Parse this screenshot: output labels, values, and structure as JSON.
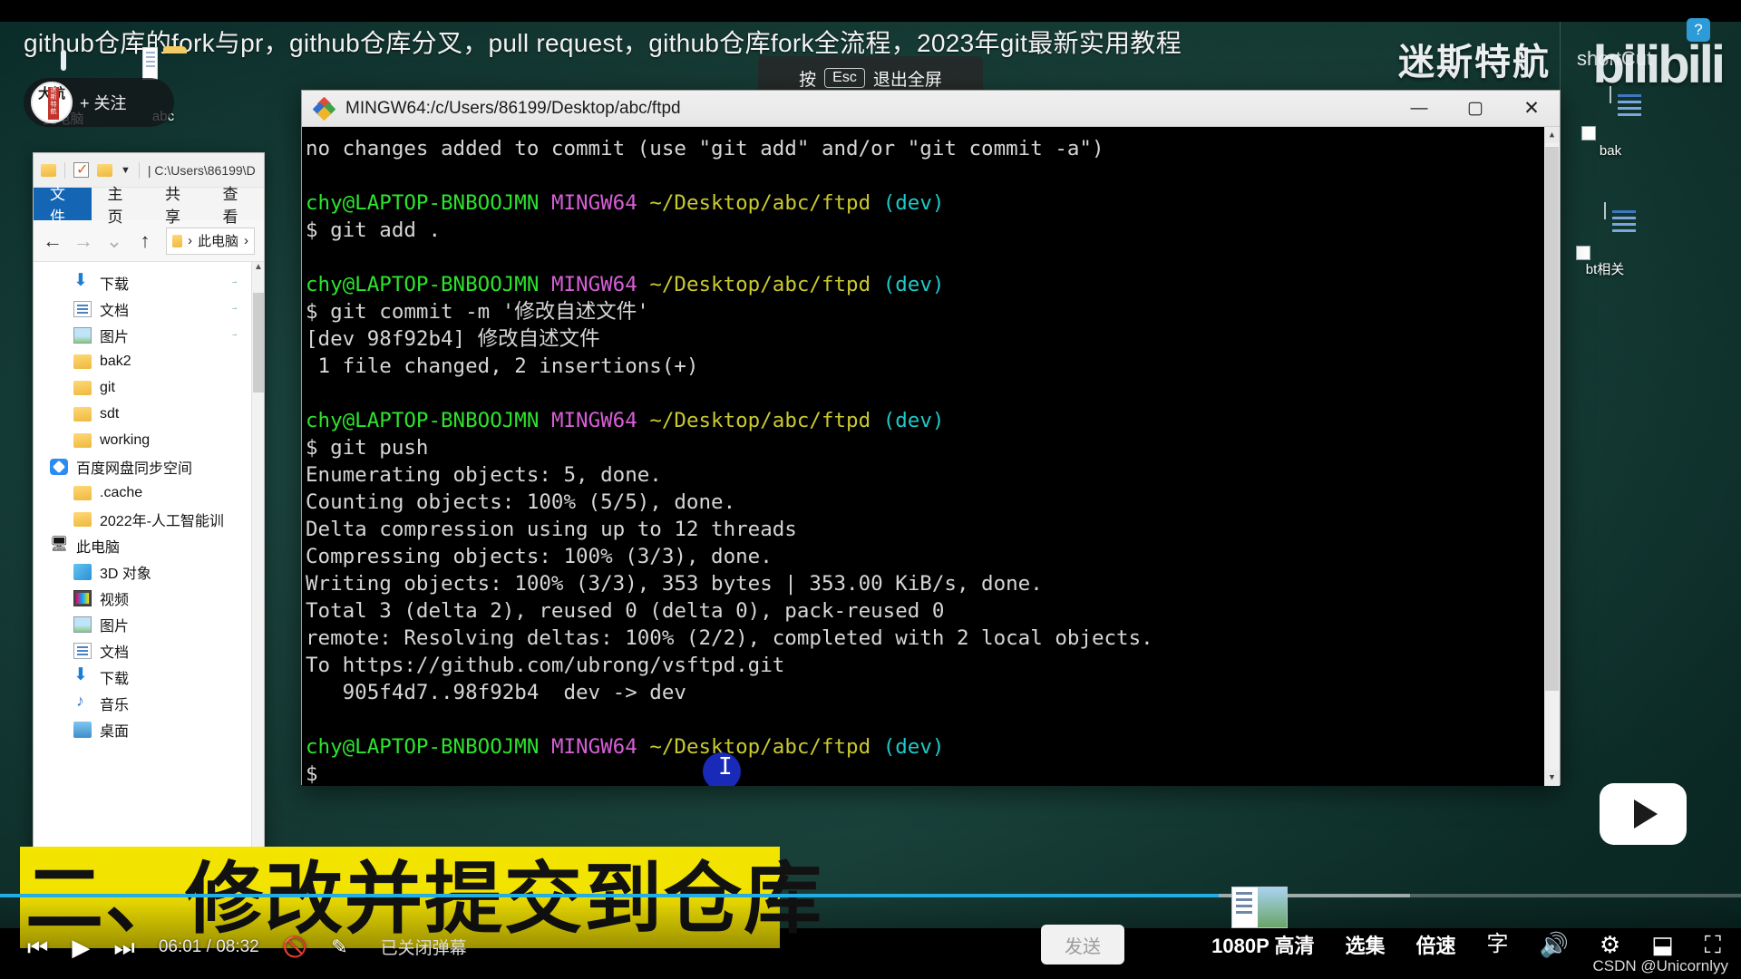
{
  "video": {
    "title": "github仓库的fork与pr，github仓库分叉，pull request，github仓库fork全流程，2023年git最新实用教程",
    "shortcut_label": "shortCut",
    "uploader": "迷斯特航",
    "brand": "bilibili",
    "help_icon": "?",
    "follow_label": "+ 关注",
    "avatar_text": "大航",
    "avatar_banner": "迷斯特航",
    "esc_hint": {
      "prefix": "按",
      "key": "Esc",
      "suffix": "退出全屏"
    },
    "subtitle": "二、修改并提交到仓库",
    "watermark": "CSDN @Unicornlyy"
  },
  "player": {
    "prev_icon": "⏮",
    "play_icon": "▶",
    "next_icon": "⏭",
    "time": "06:01 / 08:32",
    "danmaku_toggle_icon": "danmaku-off-icon",
    "danmaku_style_icon": "danmaku-style-icon",
    "danmaku_status": "已关闭弹幕",
    "send_label": "发送",
    "quality": "1080P 高清",
    "episodes": "选集",
    "speed": "倍速",
    "subtitle_icon": "subtitle-off-icon",
    "volume_icon": "volume-icon",
    "settings_icon": "gear-icon",
    "widescreen_icon": "widescreen-icon",
    "fullscreen_icon": "fullscreen-icon",
    "progress_percent": 70,
    "buffered_percent": 81
  },
  "desktop_icons": [
    {
      "label": "此电脑",
      "icon": "this-pc-icon"
    },
    {
      "label": "abc",
      "icon": "folder-icon"
    },
    {
      "label": "bak",
      "icon": "shortcut-file-icon"
    },
    {
      "label": "bt相关",
      "icon": "shortcut-file-icon"
    }
  ],
  "explorer": {
    "quick_access": {
      "path": "| C:\\Users\\86199\\D"
    },
    "tabs": [
      {
        "label": "文件",
        "active": true
      },
      {
        "label": "主页",
        "active": false
      },
      {
        "label": "共享",
        "active": false
      },
      {
        "label": "查看",
        "active": false
      }
    ],
    "nav": {
      "back": "←",
      "forward": "→",
      "recent": "⌄",
      "up": "↑"
    },
    "address": {
      "root": "此电脑",
      "chevron": "›"
    },
    "tree": [
      {
        "label": "下载",
        "icon": "download-icon",
        "pinned": true,
        "indent": 1
      },
      {
        "label": "文档",
        "icon": "documents-icon",
        "pinned": true,
        "indent": 1
      },
      {
        "label": "图片",
        "icon": "pictures-icon",
        "pinned": true,
        "indent": 1
      },
      {
        "label": "bak2",
        "icon": "folder-icon",
        "pinned": false,
        "indent": 1
      },
      {
        "label": "git",
        "icon": "folder-icon",
        "pinned": false,
        "indent": 1
      },
      {
        "label": "sdt",
        "icon": "folder-icon",
        "pinned": false,
        "indent": 1
      },
      {
        "label": "working",
        "icon": "folder-icon",
        "pinned": false,
        "indent": 1
      },
      {
        "label": "百度网盘同步空间",
        "icon": "baidu-netdisk-icon",
        "pinned": false,
        "indent": 0
      },
      {
        "label": ".cache",
        "icon": "folder-icon",
        "pinned": false,
        "indent": 1
      },
      {
        "label": "2022年-人工智能训",
        "icon": "folder-icon",
        "pinned": false,
        "indent": 1
      },
      {
        "label": "此电脑",
        "icon": "this-pc-icon",
        "pinned": false,
        "indent": 0
      },
      {
        "label": "3D 对象",
        "icon": "3d-objects-icon",
        "pinned": false,
        "indent": 1
      },
      {
        "label": "视频",
        "icon": "videos-icon",
        "pinned": false,
        "indent": 1
      },
      {
        "label": "图片",
        "icon": "pictures-icon",
        "pinned": false,
        "indent": 1
      },
      {
        "label": "文档",
        "icon": "documents-icon",
        "pinned": false,
        "indent": 1
      },
      {
        "label": "下载",
        "icon": "download-icon",
        "pinned": false,
        "indent": 1
      },
      {
        "label": "音乐",
        "icon": "music-icon",
        "pinned": false,
        "indent": 1
      },
      {
        "label": "桌面",
        "icon": "desktop-icon",
        "pinned": false,
        "indent": 1
      }
    ]
  },
  "terminal": {
    "title": "MINGW64:/c/Users/86199/Desktop/abc/ftpd",
    "minimize": "—",
    "maximize": "▢",
    "close": "✕",
    "lines": [
      {
        "segments": [
          {
            "t": "no changes added to commit (use \"git add\" and/or \"git commit -a\")",
            "c": "w"
          }
        ]
      },
      {
        "segments": [
          {
            "t": "",
            "c": "w"
          }
        ]
      },
      {
        "segments": [
          {
            "t": "chy@LAPTOP-BNBOOJMN ",
            "c": "g"
          },
          {
            "t": "MINGW64 ",
            "c": "m"
          },
          {
            "t": "~/Desktop/abc/ftpd ",
            "c": "y"
          },
          {
            "t": "(dev)",
            "c": "c"
          }
        ]
      },
      {
        "segments": [
          {
            "t": "$ git add .",
            "c": "w"
          }
        ]
      },
      {
        "segments": [
          {
            "t": "",
            "c": "w"
          }
        ]
      },
      {
        "segments": [
          {
            "t": "chy@LAPTOP-BNBOOJMN ",
            "c": "g"
          },
          {
            "t": "MINGW64 ",
            "c": "m"
          },
          {
            "t": "~/Desktop/abc/ftpd ",
            "c": "y"
          },
          {
            "t": "(dev)",
            "c": "c"
          }
        ]
      },
      {
        "segments": [
          {
            "t": "$ git commit -m '修改自述文件'",
            "c": "w"
          }
        ]
      },
      {
        "segments": [
          {
            "t": "[dev 98f92b4] 修改自述文件",
            "c": "w"
          }
        ]
      },
      {
        "segments": [
          {
            "t": " 1 file changed, 2 insertions(+)",
            "c": "w"
          }
        ]
      },
      {
        "segments": [
          {
            "t": "",
            "c": "w"
          }
        ]
      },
      {
        "segments": [
          {
            "t": "chy@LAPTOP-BNBOOJMN ",
            "c": "g"
          },
          {
            "t": "MINGW64 ",
            "c": "m"
          },
          {
            "t": "~/Desktop/abc/ftpd ",
            "c": "y"
          },
          {
            "t": "(dev)",
            "c": "c"
          }
        ]
      },
      {
        "segments": [
          {
            "t": "$ git push",
            "c": "w"
          }
        ]
      },
      {
        "segments": [
          {
            "t": "Enumerating objects: 5, done.",
            "c": "w"
          }
        ]
      },
      {
        "segments": [
          {
            "t": "Counting objects: 100% (5/5), done.",
            "c": "w"
          }
        ]
      },
      {
        "segments": [
          {
            "t": "Delta compression using up to 12 threads",
            "c": "w"
          }
        ]
      },
      {
        "segments": [
          {
            "t": "Compressing objects: 100% (3/3), done.",
            "c": "w"
          }
        ]
      },
      {
        "segments": [
          {
            "t": "Writing objects: 100% (3/3), 353 bytes | 353.00 KiB/s, done.",
            "c": "w"
          }
        ]
      },
      {
        "segments": [
          {
            "t": "Total 3 (delta 2), reused 0 (delta 0), pack-reused 0",
            "c": "w"
          }
        ]
      },
      {
        "segments": [
          {
            "t": "remote: Resolving deltas: 100% (2/2), completed with 2 local objects.",
            "c": "w"
          }
        ]
      },
      {
        "segments": [
          {
            "t": "To https://github.com/ubrong/vsftpd.git",
            "c": "w"
          }
        ]
      },
      {
        "segments": [
          {
            "t": "   905f4d7..98f92b4  dev -> dev",
            "c": "w"
          }
        ]
      },
      {
        "segments": [
          {
            "t": "",
            "c": "w"
          }
        ]
      },
      {
        "segments": [
          {
            "t": "chy@LAPTOP-BNBOOJMN ",
            "c": "g"
          },
          {
            "t": "MINGW64 ",
            "c": "m"
          },
          {
            "t": "~/Desktop/abc/ftpd ",
            "c": "y"
          },
          {
            "t": "(dev)",
            "c": "c"
          }
        ]
      },
      {
        "segments": [
          {
            "t": "$",
            "c": "w"
          }
        ]
      }
    ]
  },
  "colors": {
    "accent_blue": "#23ade5",
    "subtitle_yellow": "#f3e500",
    "term_green": "#2ee32e",
    "term_magenta": "#d65fd6",
    "term_yellow": "#c9c931",
    "term_cyan": "#1fc9c9",
    "explorer_tab_active": "#1466b5"
  }
}
